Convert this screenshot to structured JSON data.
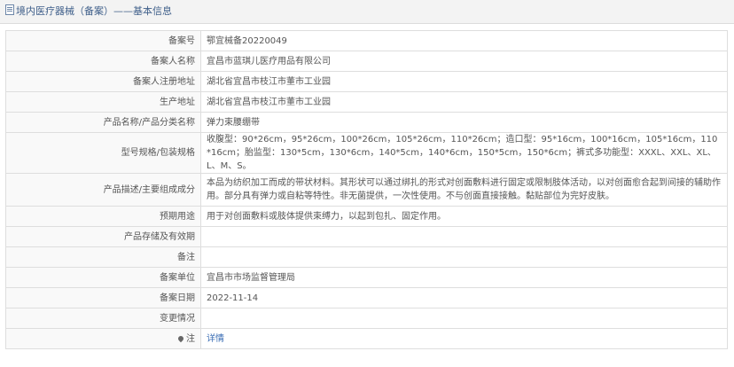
{
  "header": {
    "title": "境内医疗器械（备案）——基本信息"
  },
  "rows": [
    {
      "label": "备案号",
      "value": "鄂宜械备20220049"
    },
    {
      "label": "备案人名称",
      "value": "宜昌市蓝琪儿医疗用品有限公司"
    },
    {
      "label": "备案人注册地址",
      "value": "湖北省宜昌市枝江市董市工业园"
    },
    {
      "label": "生产地址",
      "value": "湖北省宜昌市枝江市董市工业园"
    },
    {
      "label": "产品名称/产品分类名称",
      "value": "弹力束腰绷带"
    },
    {
      "label": "型号规格/包装规格",
      "value": "收腹型：90*26cm，95*26cm，100*26cm，105*26cm，110*26cm；造口型：95*16cm，100*16cm，105*16cm，110*16cm；胎监型：130*5cm，130*6cm，140*5cm，140*6cm，150*5cm，150*6cm；裤式多功能型：XXXL、XXL、XL、L、M、S。"
    },
    {
      "label": "产品描述/主要组成成分",
      "value": "本品为纺织加工而成的带状材料。其形状可以通过绑扎的形式对创面敷料进行固定或限制肢体活动，以对创面愈合起到间接的辅助作用。部分具有弹力或自粘等特性。非无菌提供，一次性使用。不与创面直接接触。黏贴部位为完好皮肤。"
    },
    {
      "label": "预期用途",
      "value": "用于对创面敷料或肢体提供束缚力，以起到包扎、固定作用。"
    },
    {
      "label": "产品存储及有效期",
      "value": ""
    },
    {
      "label": "备注",
      "value": ""
    },
    {
      "label": "备案单位",
      "value": "宜昌市市场监督管理局"
    },
    {
      "label": "备案日期",
      "value": "2022-11-14"
    },
    {
      "label": "变更情况",
      "value": ""
    }
  ],
  "note_row": {
    "label": "注",
    "link_text": "详情"
  },
  "icons": {
    "header": "document-icon",
    "note": "location-pin-icon"
  },
  "colors": {
    "link": "#3a6db4",
    "header_text": "#3f5f8a"
  }
}
